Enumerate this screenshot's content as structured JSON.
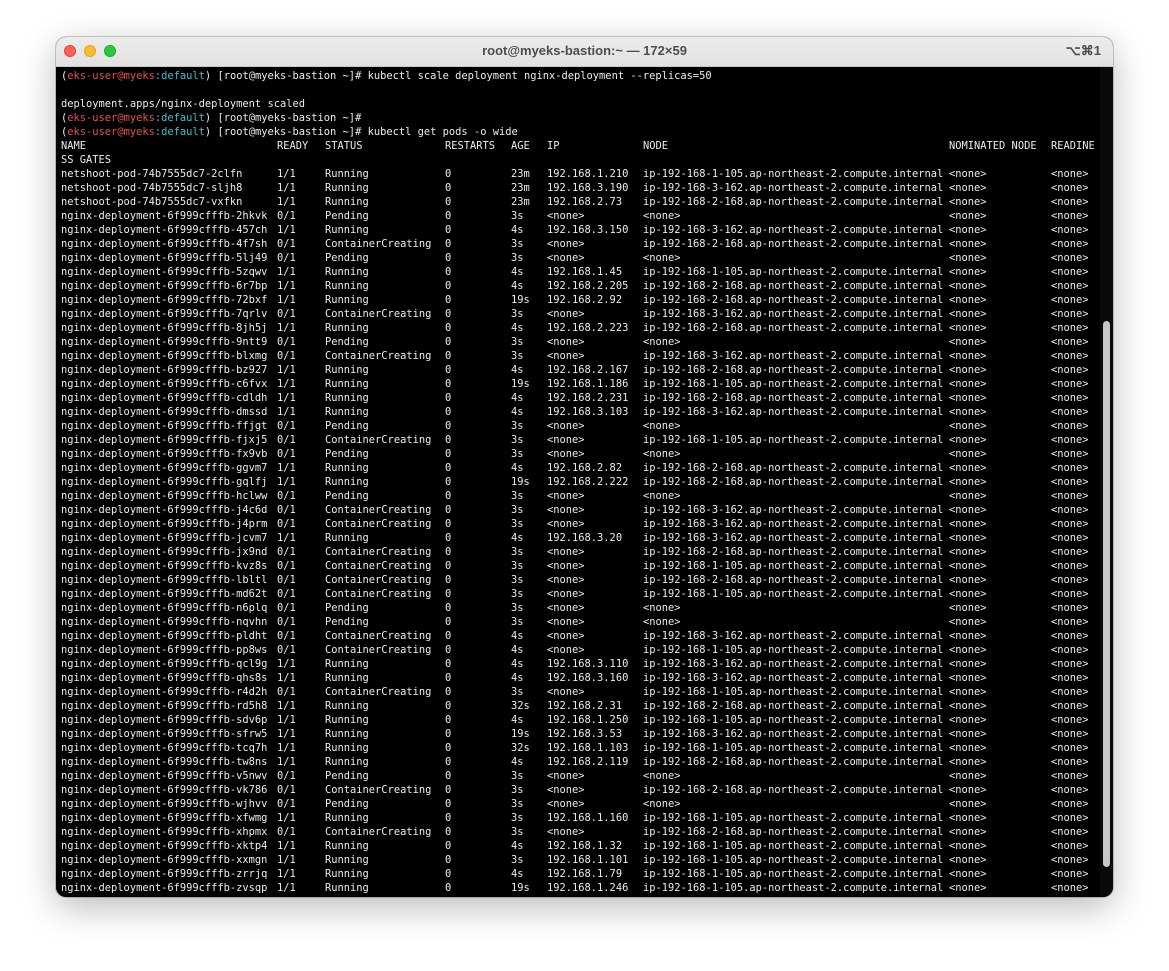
{
  "window": {
    "title": "root@myeks-bastion:~ — 172×59",
    "shortcut": "⌥⌘1"
  },
  "prompt": {
    "user": "eks-user",
    "at": "@",
    "cluster": "myeks",
    "sep": ":",
    "namespace": "default",
    "host": "[root@myeks-bastion ~]#"
  },
  "terminal": {
    "cmd1": "kubectl scale deployment nginx-deployment --replicas=50",
    "out1": "deployment.apps/nginx-deployment scaled",
    "cmd3": "kubectl get pods -o wide",
    "table": {
      "headers": [
        "NAME",
        "READY",
        "STATUS",
        "RESTARTS",
        "AGE",
        "IP",
        "NODE",
        "NOMINATED NODE",
        "READINE"
      ],
      "wrap": "SS GATES",
      "rows": [
        [
          "netshoot-pod-74b7555dc7-2clfn",
          "1/1",
          "Running",
          "0",
          "23m",
          "192.168.1.210",
          "ip-192-168-1-105.ap-northeast-2.compute.internal",
          "<none>",
          "<none>"
        ],
        [
          "netshoot-pod-74b7555dc7-sljh8",
          "1/1",
          "Running",
          "0",
          "23m",
          "192.168.3.190",
          "ip-192-168-3-162.ap-northeast-2.compute.internal",
          "<none>",
          "<none>"
        ],
        [
          "netshoot-pod-74b7555dc7-vxfkn",
          "1/1",
          "Running",
          "0",
          "23m",
          "192.168.2.73",
          "ip-192-168-2-168.ap-northeast-2.compute.internal",
          "<none>",
          "<none>"
        ],
        [
          "nginx-deployment-6f999cfffb-2hkvk",
          "0/1",
          "Pending",
          "0",
          "3s",
          "<none>",
          "<none>",
          "<none>",
          "<none>"
        ],
        [
          "nginx-deployment-6f999cfffb-457ch",
          "1/1",
          "Running",
          "0",
          "4s",
          "192.168.3.150",
          "ip-192-168-3-162.ap-northeast-2.compute.internal",
          "<none>",
          "<none>"
        ],
        [
          "nginx-deployment-6f999cfffb-4f7sh",
          "0/1",
          "ContainerCreating",
          "0",
          "3s",
          "<none>",
          "ip-192-168-2-168.ap-northeast-2.compute.internal",
          "<none>",
          "<none>"
        ],
        [
          "nginx-deployment-6f999cfffb-5lj49",
          "0/1",
          "Pending",
          "0",
          "3s",
          "<none>",
          "<none>",
          "<none>",
          "<none>"
        ],
        [
          "nginx-deployment-6f999cfffb-5zqwv",
          "1/1",
          "Running",
          "0",
          "4s",
          "192.168.1.45",
          "ip-192-168-1-105.ap-northeast-2.compute.internal",
          "<none>",
          "<none>"
        ],
        [
          "nginx-deployment-6f999cfffb-6r7bp",
          "1/1",
          "Running",
          "0",
          "4s",
          "192.168.2.205",
          "ip-192-168-2-168.ap-northeast-2.compute.internal",
          "<none>",
          "<none>"
        ],
        [
          "nginx-deployment-6f999cfffb-72bxf",
          "1/1",
          "Running",
          "0",
          "19s",
          "192.168.2.92",
          "ip-192-168-2-168.ap-northeast-2.compute.internal",
          "<none>",
          "<none>"
        ],
        [
          "nginx-deployment-6f999cfffb-7qrlv",
          "0/1",
          "ContainerCreating",
          "0",
          "3s",
          "<none>",
          "ip-192-168-3-162.ap-northeast-2.compute.internal",
          "<none>",
          "<none>"
        ],
        [
          "nginx-deployment-6f999cfffb-8jh5j",
          "1/1",
          "Running",
          "0",
          "4s",
          "192.168.2.223",
          "ip-192-168-2-168.ap-northeast-2.compute.internal",
          "<none>",
          "<none>"
        ],
        [
          "nginx-deployment-6f999cfffb-9ntt9",
          "0/1",
          "Pending",
          "0",
          "3s",
          "<none>",
          "<none>",
          "<none>",
          "<none>"
        ],
        [
          "nginx-deployment-6f999cfffb-blxmg",
          "0/1",
          "ContainerCreating",
          "0",
          "3s",
          "<none>",
          "ip-192-168-3-162.ap-northeast-2.compute.internal",
          "<none>",
          "<none>"
        ],
        [
          "nginx-deployment-6f999cfffb-bz927",
          "1/1",
          "Running",
          "0",
          "4s",
          "192.168.2.167",
          "ip-192-168-2-168.ap-northeast-2.compute.internal",
          "<none>",
          "<none>"
        ],
        [
          "nginx-deployment-6f999cfffb-c6fvx",
          "1/1",
          "Running",
          "0",
          "19s",
          "192.168.1.186",
          "ip-192-168-1-105.ap-northeast-2.compute.internal",
          "<none>",
          "<none>"
        ],
        [
          "nginx-deployment-6f999cfffb-cdldh",
          "1/1",
          "Running",
          "0",
          "4s",
          "192.168.2.231",
          "ip-192-168-2-168.ap-northeast-2.compute.internal",
          "<none>",
          "<none>"
        ],
        [
          "nginx-deployment-6f999cfffb-dmssd",
          "1/1",
          "Running",
          "0",
          "4s",
          "192.168.3.103",
          "ip-192-168-3-162.ap-northeast-2.compute.internal",
          "<none>",
          "<none>"
        ],
        [
          "nginx-deployment-6f999cfffb-ffjgt",
          "0/1",
          "Pending",
          "0",
          "3s",
          "<none>",
          "<none>",
          "<none>",
          "<none>"
        ],
        [
          "nginx-deployment-6f999cfffb-fjxj5",
          "0/1",
          "ContainerCreating",
          "0",
          "3s",
          "<none>",
          "ip-192-168-1-105.ap-northeast-2.compute.internal",
          "<none>",
          "<none>"
        ],
        [
          "nginx-deployment-6f999cfffb-fx9vb",
          "0/1",
          "Pending",
          "0",
          "3s",
          "<none>",
          "<none>",
          "<none>",
          "<none>"
        ],
        [
          "nginx-deployment-6f999cfffb-ggvm7",
          "1/1",
          "Running",
          "0",
          "4s",
          "192.168.2.82",
          "ip-192-168-2-168.ap-northeast-2.compute.internal",
          "<none>",
          "<none>"
        ],
        [
          "nginx-deployment-6f999cfffb-gqlfj",
          "1/1",
          "Running",
          "0",
          "19s",
          "192.168.2.222",
          "ip-192-168-2-168.ap-northeast-2.compute.internal",
          "<none>",
          "<none>"
        ],
        [
          "nginx-deployment-6f999cfffb-hclww",
          "0/1",
          "Pending",
          "0",
          "3s",
          "<none>",
          "<none>",
          "<none>",
          "<none>"
        ],
        [
          "nginx-deployment-6f999cfffb-j4c6d",
          "0/1",
          "ContainerCreating",
          "0",
          "3s",
          "<none>",
          "ip-192-168-3-162.ap-northeast-2.compute.internal",
          "<none>",
          "<none>"
        ],
        [
          "nginx-deployment-6f999cfffb-j4prm",
          "0/1",
          "ContainerCreating",
          "0",
          "3s",
          "<none>",
          "ip-192-168-3-162.ap-northeast-2.compute.internal",
          "<none>",
          "<none>"
        ],
        [
          "nginx-deployment-6f999cfffb-jcvm7",
          "1/1",
          "Running",
          "0",
          "4s",
          "192.168.3.20",
          "ip-192-168-3-162.ap-northeast-2.compute.internal",
          "<none>",
          "<none>"
        ],
        [
          "nginx-deployment-6f999cfffb-jx9nd",
          "0/1",
          "ContainerCreating",
          "0",
          "3s",
          "<none>",
          "ip-192-168-2-168.ap-northeast-2.compute.internal",
          "<none>",
          "<none>"
        ],
        [
          "nginx-deployment-6f999cfffb-kvz8s",
          "0/1",
          "ContainerCreating",
          "0",
          "3s",
          "<none>",
          "ip-192-168-1-105.ap-northeast-2.compute.internal",
          "<none>",
          "<none>"
        ],
        [
          "nginx-deployment-6f999cfffb-lbltl",
          "0/1",
          "ContainerCreating",
          "0",
          "3s",
          "<none>",
          "ip-192-168-2-168.ap-northeast-2.compute.internal",
          "<none>",
          "<none>"
        ],
        [
          "nginx-deployment-6f999cfffb-md62t",
          "0/1",
          "ContainerCreating",
          "0",
          "3s",
          "<none>",
          "ip-192-168-1-105.ap-northeast-2.compute.internal",
          "<none>",
          "<none>"
        ],
        [
          "nginx-deployment-6f999cfffb-n6plq",
          "0/1",
          "Pending",
          "0",
          "3s",
          "<none>",
          "<none>",
          "<none>",
          "<none>"
        ],
        [
          "nginx-deployment-6f999cfffb-nqvhn",
          "0/1",
          "Pending",
          "0",
          "3s",
          "<none>",
          "<none>",
          "<none>",
          "<none>"
        ],
        [
          "nginx-deployment-6f999cfffb-pldht",
          "0/1",
          "ContainerCreating",
          "0",
          "4s",
          "<none>",
          "ip-192-168-3-162.ap-northeast-2.compute.internal",
          "<none>",
          "<none>"
        ],
        [
          "nginx-deployment-6f999cfffb-pp8ws",
          "0/1",
          "ContainerCreating",
          "0",
          "4s",
          "<none>",
          "ip-192-168-1-105.ap-northeast-2.compute.internal",
          "<none>",
          "<none>"
        ],
        [
          "nginx-deployment-6f999cfffb-qcl9g",
          "1/1",
          "Running",
          "0",
          "4s",
          "192.168.3.110",
          "ip-192-168-3-162.ap-northeast-2.compute.internal",
          "<none>",
          "<none>"
        ],
        [
          "nginx-deployment-6f999cfffb-qhs8s",
          "1/1",
          "Running",
          "0",
          "4s",
          "192.168.3.160",
          "ip-192-168-3-162.ap-northeast-2.compute.internal",
          "<none>",
          "<none>"
        ],
        [
          "nginx-deployment-6f999cfffb-r4d2h",
          "0/1",
          "ContainerCreating",
          "0",
          "3s",
          "<none>",
          "ip-192-168-1-105.ap-northeast-2.compute.internal",
          "<none>",
          "<none>"
        ],
        [
          "nginx-deployment-6f999cfffb-rd5h8",
          "1/1",
          "Running",
          "0",
          "32s",
          "192.168.2.31",
          "ip-192-168-2-168.ap-northeast-2.compute.internal",
          "<none>",
          "<none>"
        ],
        [
          "nginx-deployment-6f999cfffb-sdv6p",
          "1/1",
          "Running",
          "0",
          "4s",
          "192.168.1.250",
          "ip-192-168-1-105.ap-northeast-2.compute.internal",
          "<none>",
          "<none>"
        ],
        [
          "nginx-deployment-6f999cfffb-sfrw5",
          "1/1",
          "Running",
          "0",
          "19s",
          "192.168.3.53",
          "ip-192-168-3-162.ap-northeast-2.compute.internal",
          "<none>",
          "<none>"
        ],
        [
          "nginx-deployment-6f999cfffb-tcq7h",
          "1/1",
          "Running",
          "0",
          "32s",
          "192.168.1.103",
          "ip-192-168-1-105.ap-northeast-2.compute.internal",
          "<none>",
          "<none>"
        ],
        [
          "nginx-deployment-6f999cfffb-tw8ns",
          "1/1",
          "Running",
          "0",
          "4s",
          "192.168.2.119",
          "ip-192-168-2-168.ap-northeast-2.compute.internal",
          "<none>",
          "<none>"
        ],
        [
          "nginx-deployment-6f999cfffb-v5nwv",
          "0/1",
          "Pending",
          "0",
          "3s",
          "<none>",
          "<none>",
          "<none>",
          "<none>"
        ],
        [
          "nginx-deployment-6f999cfffb-vk786",
          "0/1",
          "ContainerCreating",
          "0",
          "3s",
          "<none>",
          "ip-192-168-2-168.ap-northeast-2.compute.internal",
          "<none>",
          "<none>"
        ],
        [
          "nginx-deployment-6f999cfffb-wjhvv",
          "0/1",
          "Pending",
          "0",
          "3s",
          "<none>",
          "<none>",
          "<none>",
          "<none>"
        ],
        [
          "nginx-deployment-6f999cfffb-xfwmg",
          "1/1",
          "Running",
          "0",
          "3s",
          "192.168.1.160",
          "ip-192-168-1-105.ap-northeast-2.compute.internal",
          "<none>",
          "<none>"
        ],
        [
          "nginx-deployment-6f999cfffb-xhpmx",
          "0/1",
          "ContainerCreating",
          "0",
          "3s",
          "<none>",
          "ip-192-168-2-168.ap-northeast-2.compute.internal",
          "<none>",
          "<none>"
        ],
        [
          "nginx-deployment-6f999cfffb-xktp4",
          "1/1",
          "Running",
          "0",
          "4s",
          "192.168.1.32",
          "ip-192-168-1-105.ap-northeast-2.compute.internal",
          "<none>",
          "<none>"
        ],
        [
          "nginx-deployment-6f999cfffb-xxmgn",
          "1/1",
          "Running",
          "0",
          "3s",
          "192.168.1.101",
          "ip-192-168-1-105.ap-northeast-2.compute.internal",
          "<none>",
          "<none>"
        ],
        [
          "nginx-deployment-6f999cfffb-zrrjq",
          "1/1",
          "Running",
          "0",
          "4s",
          "192.168.1.79",
          "ip-192-168-1-105.ap-northeast-2.compute.internal",
          "<none>",
          "<none>"
        ],
        [
          "nginx-deployment-6f999cfffb-zvsqp",
          "1/1",
          "Running",
          "0",
          "19s",
          "192.168.1.246",
          "ip-192-168-1-105.ap-northeast-2.compute.internal",
          "<none>",
          "<none>"
        ]
      ]
    }
  },
  "scrollbar": {
    "position": 0.97
  },
  "colors": {
    "prompt_user": "#e5534b",
    "prompt_namespace": "#3ec1d3",
    "terminal_bg": "#000000",
    "terminal_fg": "#ededed"
  }
}
